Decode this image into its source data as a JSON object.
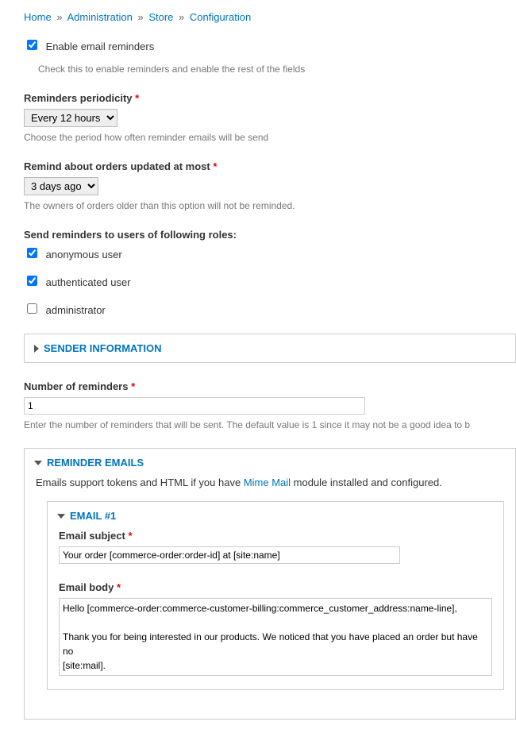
{
  "breadcrumb": {
    "home": "Home",
    "admin": "Administration",
    "store": "Store",
    "config": "Configuration",
    "sep": "»"
  },
  "enable": {
    "label": "Enable email reminders",
    "desc": "Check this to enable reminders and enable the rest of the fields"
  },
  "periodicity": {
    "label": "Reminders periodicity",
    "value": "Every 12 hours",
    "desc": "Choose the period how often reminder emails will be send"
  },
  "remind_age": {
    "label": "Remind about orders updated at most",
    "value": "3 days ago",
    "desc": "The owners of orders older than this option will not be reminded."
  },
  "roles": {
    "label": "Send reminders to users of following roles:",
    "items": [
      {
        "label": "anonymous user",
        "checked": true
      },
      {
        "label": "authenticated user",
        "checked": true
      },
      {
        "label": "administrator",
        "checked": false
      }
    ]
  },
  "sender_fieldset": {
    "legend": "SENDER INFORMATION"
  },
  "num_reminders": {
    "label": "Number of reminders",
    "value": "1",
    "desc": "Enter the number of reminders that will be sent. The default value is 1 since it may not be a good idea to b"
  },
  "emails_fieldset": {
    "legend": "REMINDER EMAILS",
    "intro_pre": "Emails support tokens and HTML if you have ",
    "intro_link": "Mime Mail",
    "intro_post": " module installed and configured."
  },
  "email1": {
    "legend": "EMAIL #1",
    "subject_label": "Email subject",
    "subject_value": "Your order [commerce-order:order-id] at [site:name]",
    "body_label": "Email body",
    "body_value": "Hello [commerce-order:commerce-customer-billing:commerce_customer_address:name-line],\n\nThank you for being interested in our products. We noticed that you have placed an order but have no\n[site:mail]."
  },
  "star": "*"
}
